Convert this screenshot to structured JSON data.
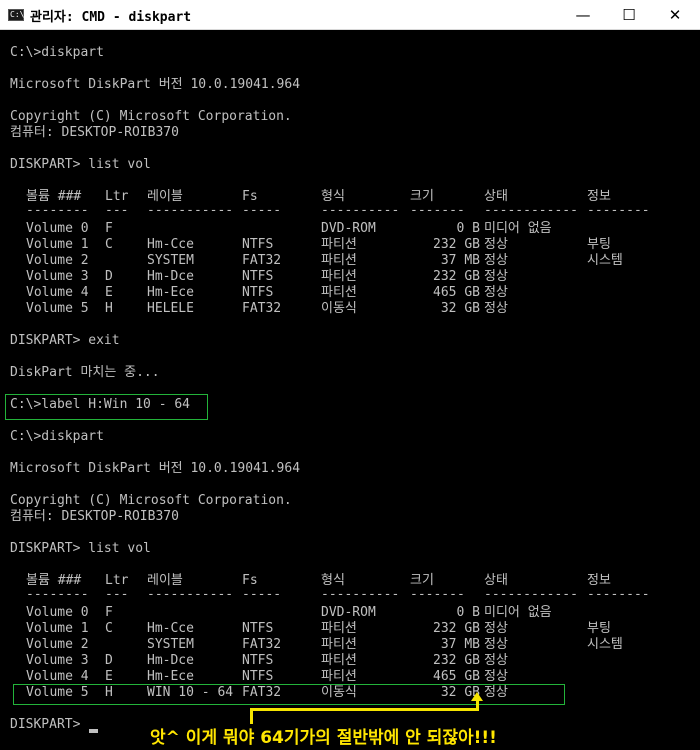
{
  "window": {
    "title": "관리자: CMD - diskpart",
    "icon_text": "C:\\"
  },
  "controls": {
    "minimize": "—",
    "maximize": "☐",
    "close": "✕"
  },
  "console": {
    "l01": "C:\\>diskpart",
    "l02": "Microsoft DiskPart 버전 10.0.19041.964",
    "l03": "Copyright (C) Microsoft Corporation.",
    "l04": "컴퓨터: DESKTOP-ROIB370",
    "l05": "DISKPART> list vol",
    "l06": "DISKPART> exit",
    "l07": "DiskPart 마치는 중...",
    "l08": "C:\\>label H:Win 10 - 64",
    "l09": "C:\\>diskpart",
    "l10": "Microsoft DiskPart 버전 10.0.19041.964",
    "l11": "Copyright (C) Microsoft Corporation.",
    "l12": "컴퓨터: DESKTOP-ROIB370",
    "l13": "DISKPART> list vol",
    "l14": "DISKPART> "
  },
  "table1": {
    "headers": [
      "볼륨 ###",
      "Ltr",
      "레이블",
      "Fs",
      "형식",
      "크기",
      "상태",
      "정보"
    ],
    "dashes": [
      "--------",
      "---",
      "-----------",
      "-----",
      "----------",
      "-------",
      "------------",
      "--------"
    ],
    "rows": [
      [
        "Volume 0",
        "F",
        "",
        "",
        "DVD-ROM",
        "0 B",
        "미디어 없음",
        ""
      ],
      [
        "Volume 1",
        "C",
        "Hm-Cce",
        "NTFS",
        "파티션",
        "232 GB",
        "정상",
        "부팅"
      ],
      [
        "Volume 2",
        "",
        "SYSTEM",
        "FAT32",
        "파티션",
        "37 MB",
        "정상",
        "시스템"
      ],
      [
        "Volume 3",
        "D",
        "Hm-Dce",
        "NTFS",
        "파티션",
        "232 GB",
        "정상",
        ""
      ],
      [
        "Volume 4",
        "E",
        "Hm-Ece",
        "NTFS",
        "파티션",
        "465 GB",
        "정상",
        ""
      ],
      [
        "Volume 5",
        "H",
        "HELELE",
        "FAT32",
        "이동식",
        "32 GB",
        "정상",
        ""
      ]
    ]
  },
  "table2": {
    "headers": [
      "볼륨 ###",
      "Ltr",
      "레이블",
      "Fs",
      "형식",
      "크기",
      "상태",
      "정보"
    ],
    "dashes": [
      "--------",
      "---",
      "-----------",
      "-----",
      "----------",
      "-------",
      "------------",
      "--------"
    ],
    "rows": [
      [
        "Volume 0",
        "F",
        "",
        "",
        "DVD-ROM",
        "0 B",
        "미디어 없음",
        ""
      ],
      [
        "Volume 1",
        "C",
        "Hm-Cce",
        "NTFS",
        "파티션",
        "232 GB",
        "정상",
        "부팅"
      ],
      [
        "Volume 2",
        "",
        "SYSTEM",
        "FAT32",
        "파티션",
        "37 MB",
        "정상",
        "시스템"
      ],
      [
        "Volume 3",
        "D",
        "Hm-Dce",
        "NTFS",
        "파티션",
        "232 GB",
        "정상",
        ""
      ],
      [
        "Volume 4",
        "E",
        "Hm-Ece",
        "NTFS",
        "파티션",
        "465 GB",
        "정상",
        ""
      ],
      [
        "Volume 5",
        "H",
        "WIN 10 - 64",
        "FAT32",
        "이동식",
        "32 GB",
        "정상",
        ""
      ]
    ]
  },
  "annotation": {
    "text": "앗^ 이게 뭐야 64기가의 절반밖에 안 되잖아!!!"
  },
  "colors": {
    "console_bg": "#000000",
    "console_text": "#c0c0c0",
    "highlight_box": "#23b33a",
    "annotation": "#ffe600"
  }
}
